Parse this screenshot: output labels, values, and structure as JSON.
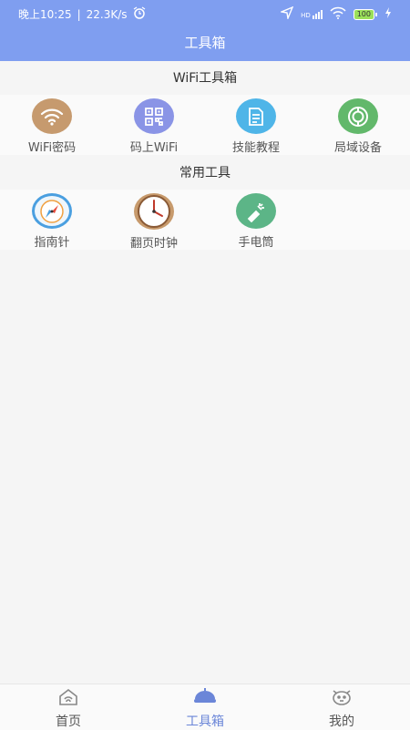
{
  "status": {
    "time": "晚上10:25",
    "speed": "22.3K/s",
    "net": "HD",
    "battery": "100"
  },
  "title": "工具箱",
  "sections": [
    {
      "title": "WiFi工具箱",
      "items": [
        {
          "label": "WiFi密码",
          "icon": "wifi-icon",
          "color": "#c69a6e"
        },
        {
          "label": "码上WiFi",
          "icon": "qr-code-icon",
          "color": "#8a94e6"
        },
        {
          "label": "技能教程",
          "icon": "document-icon",
          "color": "#4fb5e8"
        },
        {
          "label": "局域设备",
          "icon": "lan-device-icon",
          "color": "#62b86b"
        }
      ]
    },
    {
      "title": "常用工具",
      "items": [
        {
          "label": "指南针",
          "icon": "compass-icon",
          "color": "#4a9fe0"
        },
        {
          "label": "翻页时钟",
          "icon": "clock-icon",
          "color": "#c79a6c"
        },
        {
          "label": "手电筒",
          "icon": "flashlight-icon",
          "color": "#5cb587"
        }
      ]
    }
  ],
  "nav": [
    {
      "label": "首页",
      "icon": "home-icon",
      "active": false
    },
    {
      "label": "工具箱",
      "icon": "toolbox-icon",
      "active": true
    },
    {
      "label": "我的",
      "icon": "profile-icon",
      "active": false
    }
  ],
  "colors": {
    "header": "#7f9ef0",
    "active_nav": "#6b86d8",
    "background": "#f5f5f5"
  }
}
